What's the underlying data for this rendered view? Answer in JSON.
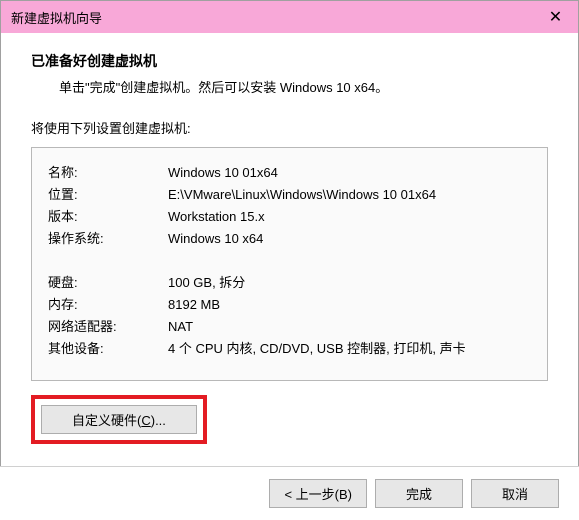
{
  "titlebar": {
    "title": "新建虚拟机向导",
    "close": "✕"
  },
  "header": {
    "title": "已准备好创建虚拟机",
    "subtitle": "单击\"完成\"创建虚拟机。然后可以安装 Windows 10 x64。"
  },
  "section_label": "将使用下列设置创建虚拟机:",
  "info": {
    "name_label": "名称:",
    "name_value": "Windows 10 01x64",
    "location_label": "位置:",
    "location_value": "E:\\VMware\\Linux\\Windows\\Windows 10 01x64",
    "version_label": "版本:",
    "version_value": "Workstation 15.x",
    "os_label": "操作系统:",
    "os_value": "Windows 10 x64",
    "disk_label": "硬盘:",
    "disk_value": "100 GB, 拆分",
    "memory_label": "内存:",
    "memory_value": "8192 MB",
    "network_label": "网络适配器:",
    "network_value": "NAT",
    "other_label": "其他设备:",
    "other_value": "4 个 CPU 内核, CD/DVD, USB 控制器, 打印机, 声卡"
  },
  "buttons": {
    "customize_pre": "自定义硬件(",
    "customize_key": "C",
    "customize_post": ")...",
    "back": "< 上一步(B)",
    "finish": "完成",
    "cancel": "取消"
  }
}
